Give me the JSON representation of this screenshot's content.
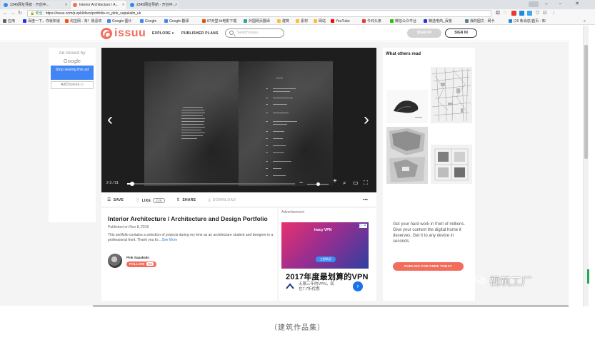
{
  "browser": {
    "tabs": [
      {
        "title": "2345网址导航 - 开创中..."
      },
      {
        "title": "Interior Architecture / A..."
      },
      {
        "title": "2345网址导航 - 开创中..."
      }
    ],
    "security_label": "安全",
    "url": "https://issuu.com/p.spkl/docs/portfolio-cv_plnk_supakalin_uk",
    "bookmarks": [
      "应用",
      "百度一下，你就知道",
      "淘宝网 - 淘！我喜欢",
      "Google 图片",
      "Google",
      "Google 翻译",
      "87天堂-bt电影下载",
      "外国网页翻译",
      "建筑",
      "素材",
      "网站",
      "YouTube",
      "今日头条",
      "微信公众平台",
      "精选电商_百度",
      "我的图文 - 网卡",
      "(16 条消息)首页 - 知"
    ]
  },
  "header": {
    "logo": "issuu",
    "explore": "EXPLORE ▾",
    "publisher_plans": "PUBLISHER PLANS",
    "search_placeholder": "Search issuu",
    "sign_up": "SIGN UP",
    "sign_in": "SIGN IN"
  },
  "left_ad": {
    "closed_by": "Ad closed by",
    "brand": "Google",
    "stop_label": "Stop seeing this ad",
    "adchoices": "AdChoices ▷"
  },
  "viewer": {
    "page_count": "2-3 / 91",
    "prev": "‹",
    "next": "›",
    "progress_fraction": 0.03,
    "zoom_in": "+",
    "zoom_out": "−"
  },
  "toolbar": {
    "save": "SAVE",
    "like": "LIKE",
    "like_count": "236",
    "share": "SHARE",
    "download": "DOWNLOAD",
    "more": "•••"
  },
  "doc": {
    "title": "Interior Architecture / Architecture and Design Portfolio",
    "published": "Published on Nov 8, 2016",
    "description": "This portfolio contains a selection of projects during my time as an architecture student and designer in a professional front. Thank you fo...",
    "see_more": "See More",
    "author": "Pink Supakalin",
    "follow": "FOLLOW",
    "follow_count": "94"
  },
  "mid_ad": {
    "label": "Advertisement",
    "brand": "Ivacy VPN",
    "close": "▷ ✕",
    "cta": "立即购买",
    "headline": "2017年度最划算的VPN",
    "sub": "无限三年的VPN，现在7.7折优惠"
  },
  "right_col": {
    "title": "What others read",
    "promo_text": "Get your hard work in front of millions. Give your content the digital home it deserves. Get it to any device in seconds.",
    "promo_button": "PUBLISH FOR FREE TODAY"
  },
  "watermark": "视筑工厂",
  "caption": "（建筑作品集）",
  "colors": {
    "brand": "#f36d5d",
    "google_blue": "#4285f4",
    "viewer_bg": "#1e1e1e"
  }
}
